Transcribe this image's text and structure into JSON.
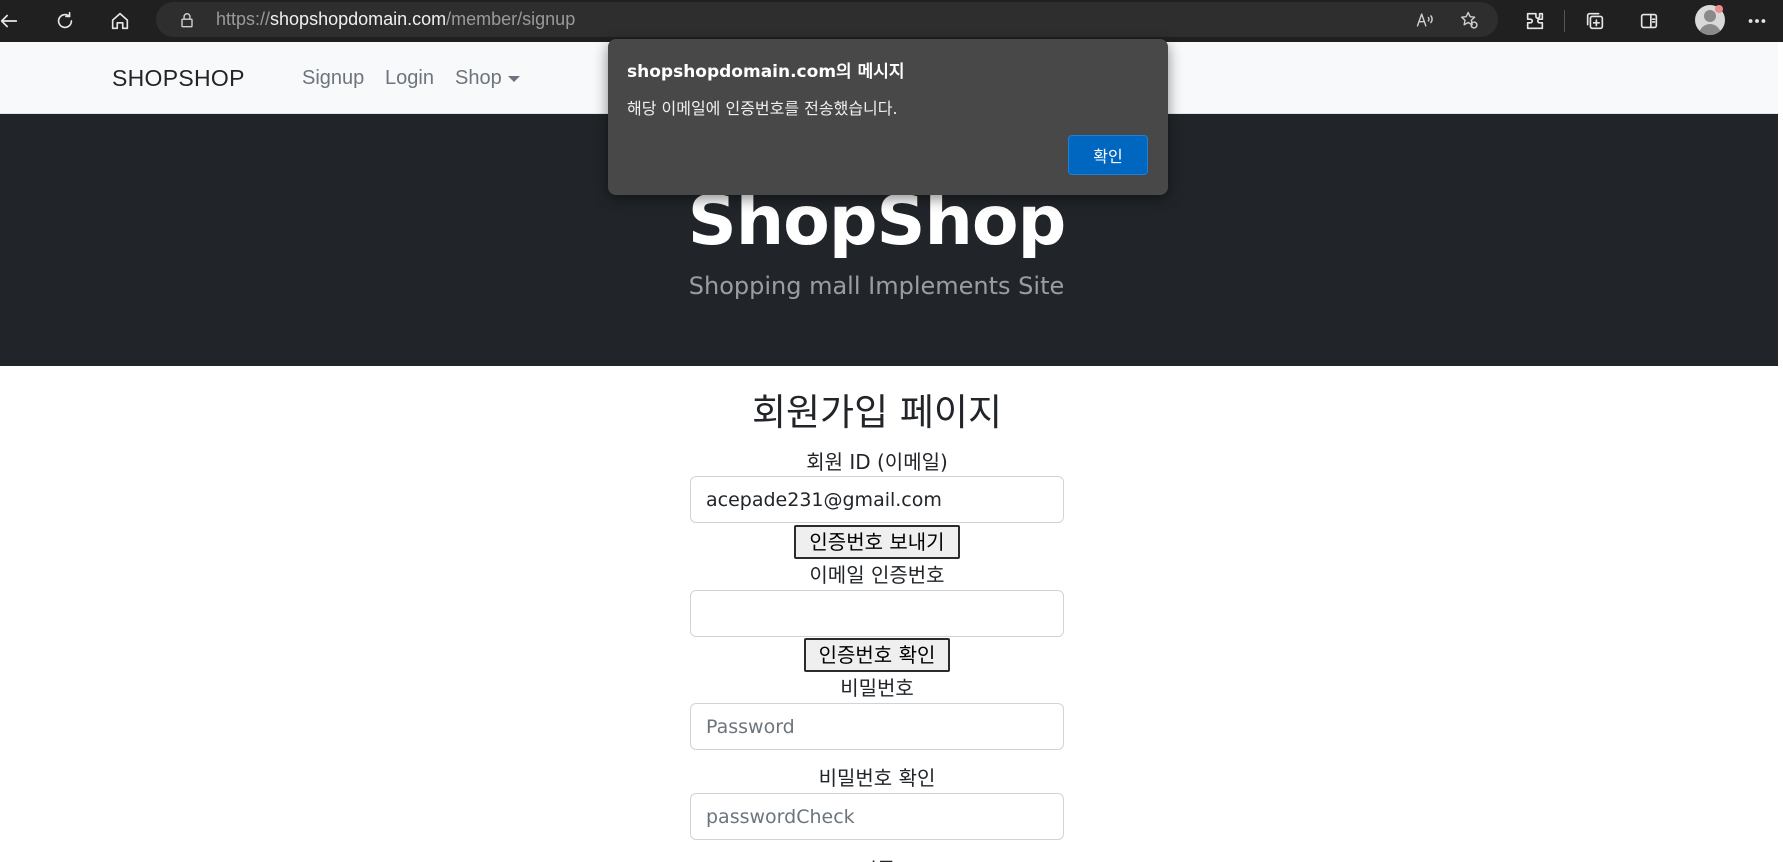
{
  "browser": {
    "url_prefix": "https://",
    "url_host": "shopshopdomain.com",
    "url_path": "/member/signup"
  },
  "navbar": {
    "brand": "SHOPSHOP",
    "links": [
      "Signup",
      "Login",
      "Shop"
    ]
  },
  "hero": {
    "title": "ShopShop",
    "subtitle": "Shopping mall Implements Site"
  },
  "form": {
    "heading": "회원가입 페이지",
    "email_label": "회원 ID (이메일)",
    "email_value": "acepade231@gmail.com",
    "send_code_button": "인증번호 보내기",
    "code_label": "이메일 인증번호",
    "code_value": "",
    "verify_code_button": "인증번호 확인",
    "password_label": "비밀번호",
    "password_placeholder": "Password",
    "password_check_label": "비밀번호 확인",
    "password_check_placeholder": "passwordCheck",
    "name_label": "이름"
  },
  "dialog": {
    "title": "shopshopdomain.com의 메시지",
    "message": "해당 이메일에 인증번호를 전송했습니다.",
    "ok_button": "확인",
    "ok_color": "#0067c0"
  },
  "icons": [
    "back-arrow-icon",
    "refresh-icon",
    "home-icon",
    "lock-icon",
    "read-aloud-icon",
    "favorite-add-icon",
    "extensions-icon",
    "collections-icon",
    "sidebar-icon",
    "profile-icon",
    "more-icon"
  ]
}
